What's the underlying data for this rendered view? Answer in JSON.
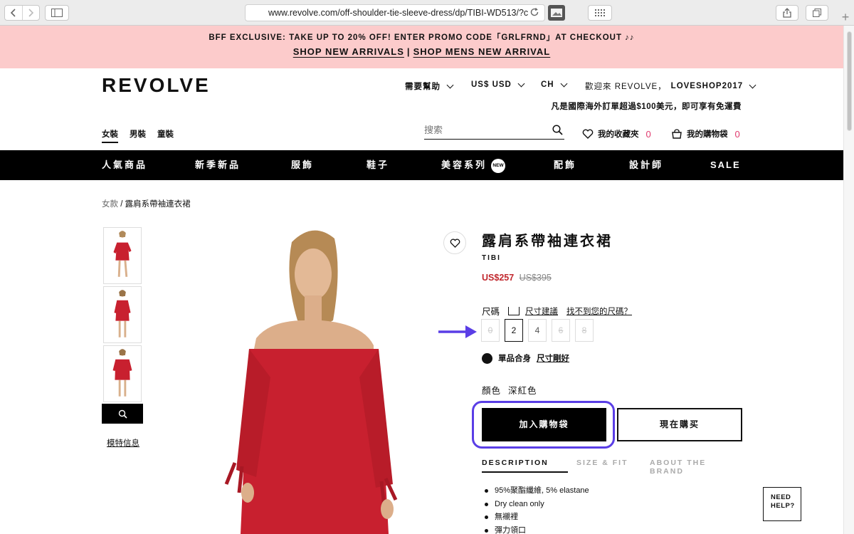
{
  "browser": {
    "url": "www.revolve.com/off-shoulder-tie-sleeve-dress/dp/TIBI-WD513/?c",
    "back_icon": "chevron-left-icon",
    "forward_icon": "chevron-right-icon",
    "plus_label": "+"
  },
  "promo": {
    "line1": "BFF EXCLUSIVE: TAKE UP TO 20% OFF! ENTER PROMO CODE「GRLFRND」AT CHECKOUT ♪♪",
    "link1": "SHOP NEW ARRIVALS",
    "separator": "|",
    "link2": "SHOP MENS NEW ARRIVAL",
    "bg_color": "#fccbcb"
  },
  "header": {
    "logo": "REVOLVE",
    "help": "需要幫助",
    "currency": "US$ USD",
    "region": "CH",
    "welcome": "歡迎來 REVOLVE，",
    "username": "LOVESHOP2017",
    "shipping_note": "凡是國際海外訂單超過$100美元，即可享有免運費",
    "gender_tabs": [
      {
        "label": "女裝",
        "active": true
      },
      {
        "label": "男裝",
        "active": false
      },
      {
        "label": "童裝",
        "active": false
      }
    ],
    "search_placeholder": "搜索",
    "wishlist_label": "我的收藏夾",
    "wishlist_count": "0",
    "bag_label": "我的購物袋",
    "bag_count": "0"
  },
  "categories": [
    {
      "label": "人氣商品"
    },
    {
      "label": "新季新品"
    },
    {
      "label": "服飾"
    },
    {
      "label": "鞋子"
    },
    {
      "label": "美容系列",
      "badge": "NEW"
    },
    {
      "label": "配飾"
    },
    {
      "label": "設計師"
    },
    {
      "label": "SALE"
    }
  ],
  "breadcrumb": {
    "parent": "女款",
    "separator": "/",
    "current": "露肩系帶袖連衣裙"
  },
  "gallery": {
    "model_info": "模特信息",
    "zoom_icon": "magnifier-icon"
  },
  "product": {
    "title": "露肩系帶袖連衣裙",
    "brand": "TIBI",
    "price_sale": "US$257",
    "price_original": "US$395",
    "size_label": "尺碼",
    "size_guide": "尺寸建議",
    "size_missing": "找不到您的尺碼？",
    "sizes": [
      {
        "label": "0",
        "available": false,
        "selected": false
      },
      {
        "label": "2",
        "available": true,
        "selected": true
      },
      {
        "label": "4",
        "available": true,
        "selected": false
      },
      {
        "label": "6",
        "available": false,
        "selected": false
      },
      {
        "label": "8",
        "available": false,
        "selected": false
      }
    ],
    "fit_label": "單品合身",
    "fit_value": "尺寸剛好",
    "color_label": "顏色",
    "color_value": "深紅色",
    "dress_color": "#c8202f",
    "add_to_bag": "加入購物袋",
    "buy_now": "現在購买",
    "tabs": [
      {
        "label": "DESCRIPTION",
        "active": true
      },
      {
        "label": "SIZE & FIT",
        "active": false
      },
      {
        "label": "ABOUT THE BRAND",
        "active": false
      }
    ],
    "description": [
      "95%聚酯纖維, 5% elastane",
      "Dry clean only",
      "無襯裡",
      "彈力領口"
    ]
  },
  "help_widget": {
    "line1": "NEED",
    "line2": "HELP?"
  },
  "annotations": {
    "highlight_color": "#5a3ee6"
  }
}
